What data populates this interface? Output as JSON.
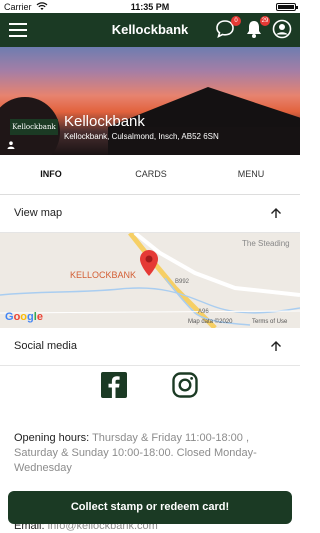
{
  "status_bar": {
    "carrier": "Carrier",
    "time": "11:35 PM"
  },
  "app_bar": {
    "title": "Kellockbank",
    "chat_badge": "0",
    "notification_badge": "29"
  },
  "hero": {
    "logo_text": "Kellockbank",
    "name": "Kellockbank",
    "address": "Kellockbank, Culsalmond, Insch, AB52 6SN"
  },
  "tabs": [
    {
      "label": "INFO"
    },
    {
      "label": "CARDS"
    },
    {
      "label": "MENU"
    }
  ],
  "map_section": {
    "label": "View map"
  },
  "map": {
    "place_label": "KELLOCKBANK",
    "road_label_1": "B992",
    "road_label_2": "A96",
    "area_label": "The Steading",
    "attribution": "Map data ©2020",
    "terms": "Terms of Use",
    "google_logo": "Google"
  },
  "social_section": {
    "label": "Social media"
  },
  "info": {
    "hours_label": "Opening hours:",
    "hours_value": "Thursday & Friday 11:00-18:00 , Saturday & Sunday 10:00-18:00. Closed Monday-Wednesday",
    "email_label": "Email:",
    "email_value": "info@kellockbank.com"
  },
  "cta": {
    "label": "Collect stamp or redeem card!"
  },
  "colors": {
    "brand": "#1b3a24",
    "badge": "#e53935",
    "pin": "#e53935"
  }
}
